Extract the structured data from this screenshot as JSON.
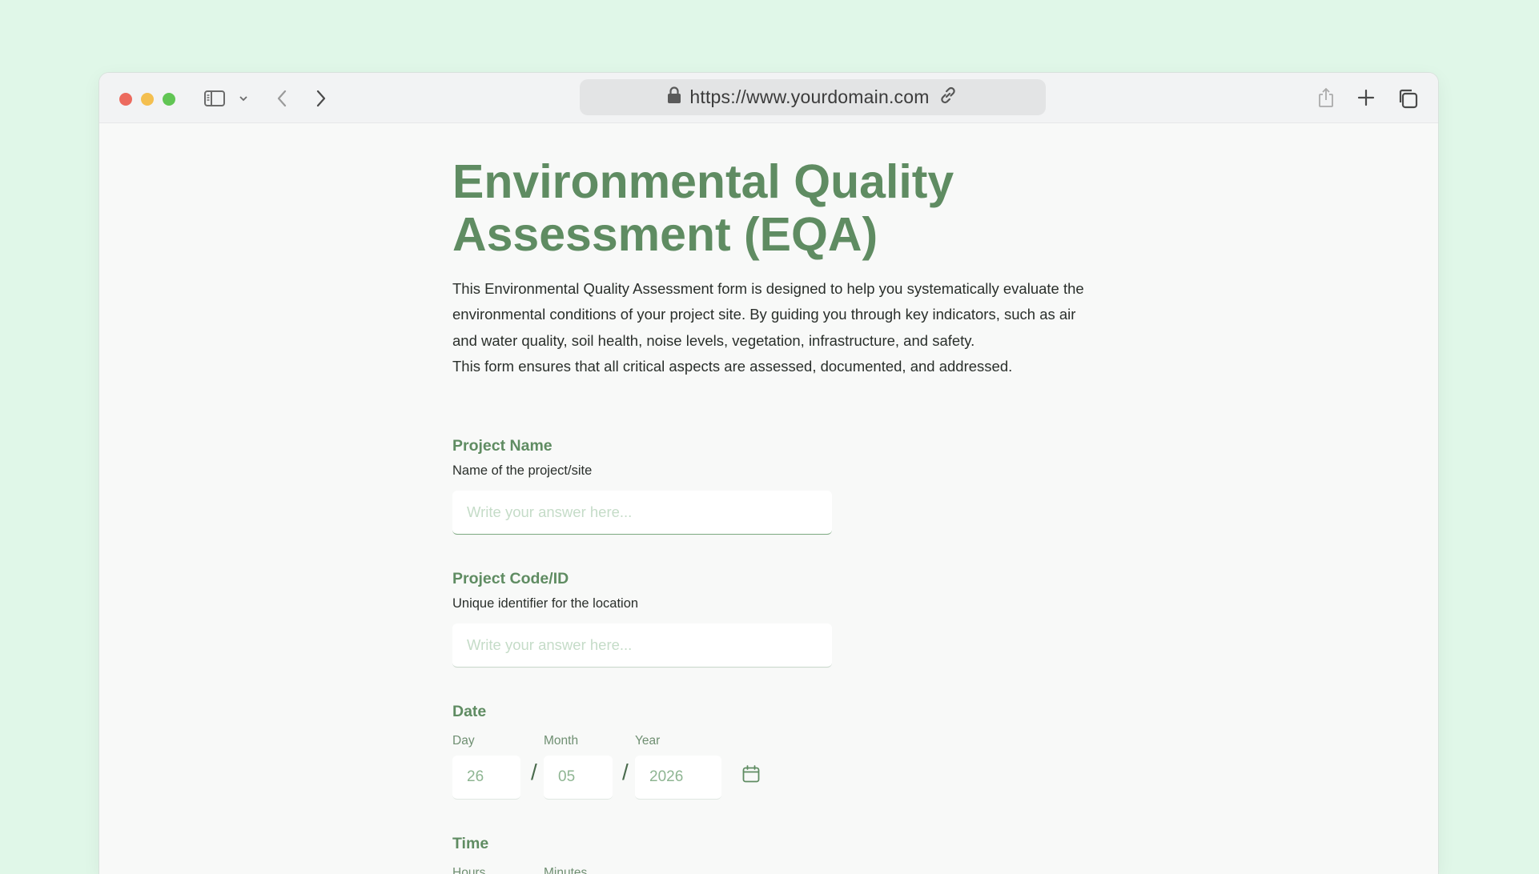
{
  "browser": {
    "url": "https://www.yourdomain.com",
    "icons": [
      "sidebar-icon",
      "chevron-down-icon",
      "back-icon",
      "forward-icon",
      "lock-icon",
      "link-icon",
      "share-icon",
      "new-tab-icon",
      "tabs-icon"
    ]
  },
  "form": {
    "title": "Environmental Quality Assessment (EQA)",
    "description": [
      "This Environmental Quality Assessment form is designed to help you systematically evaluate the environmental conditions of your project site. By guiding you through key indicators, such as air and water quality, soil health, noise levels, vegetation, infrastructure, and safety.",
      "This form ensures that all critical aspects are assessed, documented, and addressed."
    ],
    "project_name": {
      "label": "Project Name",
      "help": "Name of the project/site",
      "placeholder": "Write your answer here..."
    },
    "project_code": {
      "label": "Project Code/ID",
      "help": "Unique identifier for the location",
      "placeholder": "Write your answer here..."
    },
    "date": {
      "label": "Date",
      "day_label": "Day",
      "month_label": "Month",
      "year_label": "Year",
      "day_value": "26",
      "month_value": "05",
      "year_value": "2026",
      "separator": "/"
    },
    "time": {
      "label": "Time",
      "hours_label": "Hours",
      "minutes_label": "Minutes"
    }
  },
  "colors": {
    "accent": "#5f8c62",
    "background": "#e0f7e8"
  }
}
